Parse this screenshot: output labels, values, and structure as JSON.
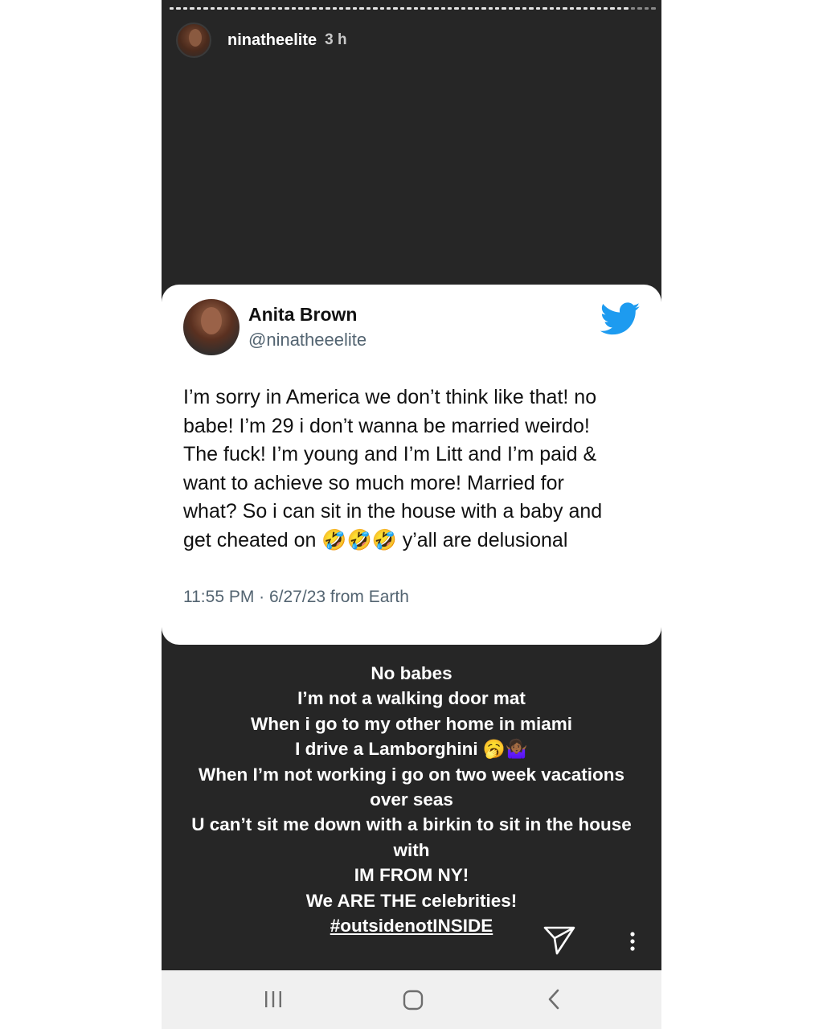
{
  "story": {
    "username": "ninatheelite",
    "time": "3 h"
  },
  "tweet": {
    "display_name": "Anita Brown",
    "handle": "@ninatheeelite",
    "text_lines": [
      "I’m sorry in America we don’t think like that! no",
      "babe! I’m 29 i don’t wanna be married weirdo!",
      "The fuck! I’m young and I’m Litt and I’m paid &",
      "want to achieve so much more! Married for",
      "what? So i can sit in the house with a baby and",
      "get cheated on 🤣🤣🤣 y’all are delusional"
    ],
    "meta": "11:55 PM · 6/27/23 from Earth"
  },
  "caption": {
    "lines": [
      "No babes",
      "I’m not a walking door mat",
      "When i go to my other home in miami",
      "I drive a Lamborghini 🥱🤷🏾‍♀️",
      "When I’m not working i go on two week vacations",
      "over seas",
      "U can’t sit me down with a birkin to sit in the house",
      "with",
      "IM FROM NY!",
      "We ARE THE celebrities!"
    ],
    "hashtag": "#outsidenotINSIDE"
  },
  "icons": {
    "twitter": "twitter-bird-icon",
    "send": "send-icon",
    "more": "more-vertical-icon",
    "recents": "recents-icon",
    "home": "home-icon",
    "back": "back-icon"
  },
  "colors": {
    "story_bg": "#262626",
    "twitter_blue": "#1d9bf0",
    "handle_gray": "#536471",
    "navbar_bg": "#f0f0f0"
  }
}
